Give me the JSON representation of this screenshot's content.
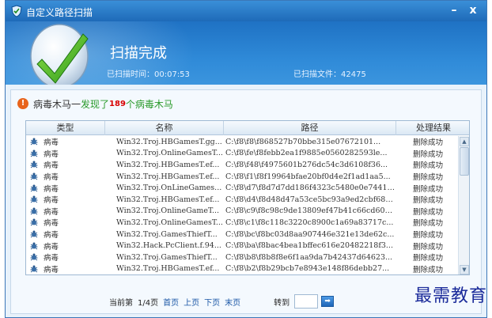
{
  "window": {
    "title": "自定义路径扫描",
    "minimize": "–",
    "close": "x"
  },
  "header": {
    "title": "扫描完成",
    "elapsed": "已扫描时间：00:07:53",
    "files": "已扫描文件：42475"
  },
  "summary": {
    "category": "病毒木马一",
    "found_prefix": "发现了",
    "count": "189",
    "found_suffix": "个病毒木马"
  },
  "table": {
    "columns": [
      "类型",
      "名称",
      "路径",
      "处理结果"
    ],
    "rows": [
      {
        "type": "病毒",
        "name": "Win32.Troj.HBGamesT.gg...",
        "path": "C:\\f8\\f8\\f868527b70bbe315e07672101...",
        "result": "删除成功"
      },
      {
        "type": "病毒",
        "name": "Win32.Troj.OnlineGamesT...",
        "path": "C:\\f8\\fe\\f8febb2ea1f9885e0560282593le...",
        "result": "删除成功"
      },
      {
        "type": "病毒",
        "name": "Win32.Troj.HBGamesT.ef...",
        "path": "C:\\f8\\f48\\f4975601b276dc54c3d6108f36...",
        "result": "删除成功"
      },
      {
        "type": "病毒",
        "name": "Win32.Troj.HBGamesT.ef...",
        "path": "C:\\f8\\f1\\f8f19964bfae20bf0d4e2f1ad1aa5...",
        "result": "删除成功"
      },
      {
        "type": "病毒",
        "name": "Win32.Troj.OnLineGames...",
        "path": "C:\\f8\\d7\\f8d7d7dd186f4323c5480e0e744101f...",
        "result": "删除成功"
      },
      {
        "type": "病毒",
        "name": "Win32.Troj.HBGamesT.ef...",
        "path": "C:\\f8\\d4\\f8d48d47a53ce5bc93a9ed2cbf6805c...",
        "result": "删除成功"
      },
      {
        "type": "病毒",
        "name": "Win32.Troj.OnlineGameT...",
        "path": "C:\\f8\\c9\\f8c98c9de13809ef47b41c66cd6003c...",
        "result": "删除成功"
      },
      {
        "type": "病毒",
        "name": "Win32.Troj.OnlineGamesT...",
        "path": "C:\\f8\\c1\\f8c118c3220c8900c1a69a83717c...",
        "result": "删除成功"
      },
      {
        "type": "病毒",
        "name": "Win32.Troj.GamesThiefT...",
        "path": "C:\\f8\\bc\\f8bc03d8aa907446e321e13de62c...",
        "result": "删除成功"
      },
      {
        "type": "病毒",
        "name": "Win32.Hack.PcClient.f.94...",
        "path": "C:\\f8\\ba\\f8bac4bea1bffec616e20482218f3...",
        "result": "删除成功"
      },
      {
        "type": "病毒",
        "name": "Win32.Troj.GamesThiefT...",
        "path": "C:\\f8\\b8\\f8b8f8e6f1aa9da7b42437d64623...",
        "result": "删除成功"
      },
      {
        "type": "病毒",
        "name": "Win32.Troj.HBGamesT.ef...",
        "path": "C:\\f8\\b2\\f8b29bcb7e8943e148f86debb27...",
        "result": "删除成功"
      }
    ]
  },
  "pager": {
    "current": "当前第",
    "page": "1/4页",
    "first": "首页",
    "prev": "上页",
    "next": "下页",
    "last": "末页",
    "goto": "转到",
    "goto_value": ""
  },
  "watermark": "最需教育",
  "colors": {
    "accent": "#1f72c4",
    "found": "#2a9a2a",
    "count": "#d80000",
    "warn": "#e8641c"
  }
}
